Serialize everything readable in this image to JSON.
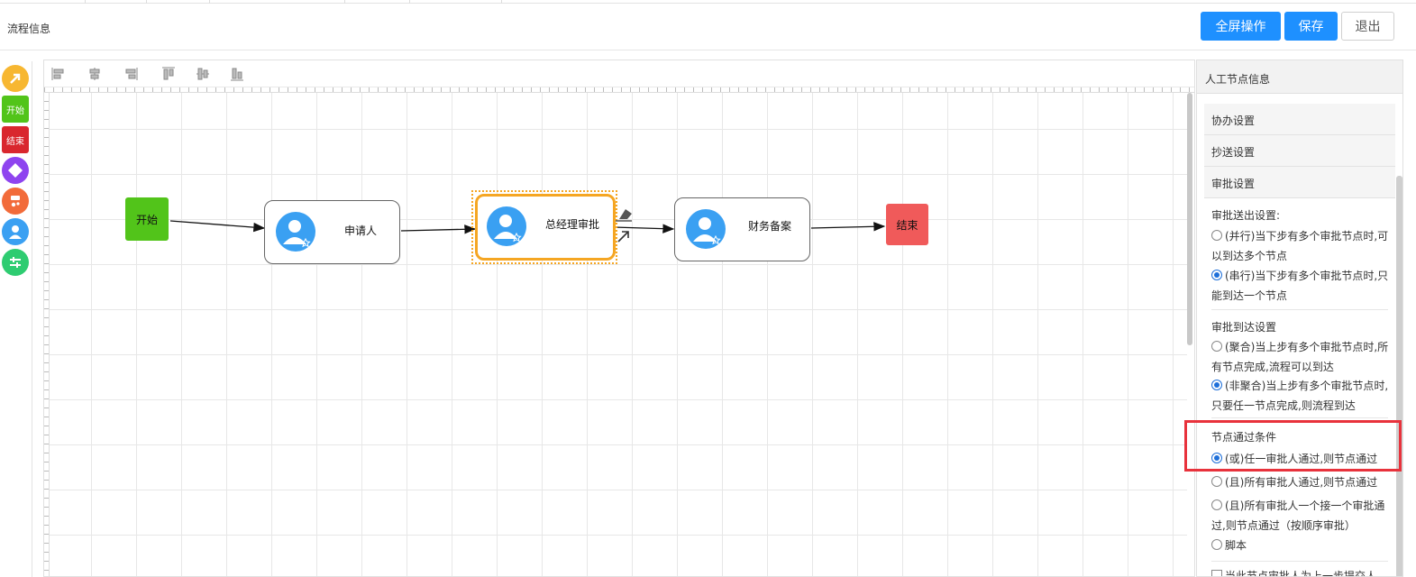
{
  "header": {
    "title": "流程信息",
    "buttons": {
      "fullscreen": "全屏操作",
      "save": "保存",
      "exit": "退出"
    }
  },
  "palette": {
    "items": [
      {
        "name": "connector-arrow-icon",
        "color": "#f7b731"
      },
      {
        "name": "start-node",
        "label": "开始",
        "color": "#52c41a"
      },
      {
        "name": "end-node",
        "label": "结束",
        "color": "#d9272e"
      },
      {
        "name": "gateway-diamond-icon",
        "color": "#8e44ef"
      },
      {
        "name": "subprocess-icon",
        "color": "#f26b3a"
      },
      {
        "name": "user-task-icon",
        "color": "#3aa0f2"
      },
      {
        "name": "parallel-icon",
        "color": "#2ecc71"
      }
    ]
  },
  "canvas": {
    "toolbar_icons": [
      "align-left-icon",
      "align-center-icon",
      "align-right-icon",
      "align-top-icon",
      "align-middle-icon",
      "align-bottom-icon"
    ],
    "nodes": {
      "start": "开始",
      "applicant": "申请人",
      "gm_approval": "总经理审批",
      "finance": "财务备案",
      "end": "结束"
    },
    "colors": {
      "start": "#52c41a",
      "end": "#f05a5a",
      "selected": "#f5a623",
      "avatar": "#3aa0f2"
    }
  },
  "panel": {
    "title": "人工节点信息",
    "sections": {
      "assist": "协办设置",
      "cc": "抄送设置",
      "approval": "审批设置"
    },
    "send_out": {
      "title": "审批送出设置:",
      "options": [
        {
          "line1": "(并行)当下步有多个审批节点时,可",
          "line2": "以到达多个节点",
          "selected": false
        },
        {
          "line1": "(串行)当下步有多个审批节点时,只",
          "line2": "能到达一个节点",
          "selected": true
        }
      ]
    },
    "arrival": {
      "title": "审批到达设置",
      "options": [
        {
          "line1": "(聚合)当上步有多个审批节点时,所",
          "line2": "有节点完成,流程可以到达",
          "selected": false
        },
        {
          "line1": "(非聚合)当上步有多个审批节点时,",
          "line2": "只要任一节点完成,则流程到达",
          "selected": true
        }
      ]
    },
    "pass_condition": {
      "title": "节点通过条件",
      "options": [
        {
          "line1": "(或)任一审批人通过,则节点通过",
          "line2": "",
          "selected": true
        },
        {
          "line1": "(且)所有审批人通过,则节点通过",
          "line2": "",
          "selected": false
        },
        {
          "line1": "(且)所有审批人一个接一个审批通",
          "line2": "过,则节点通过（按顺序审批）",
          "selected": false
        },
        {
          "line1": "脚本",
          "line2": "",
          "selected": false
        }
      ]
    },
    "bottom_checkbox": "当此节点审批人为上一步提交人"
  }
}
